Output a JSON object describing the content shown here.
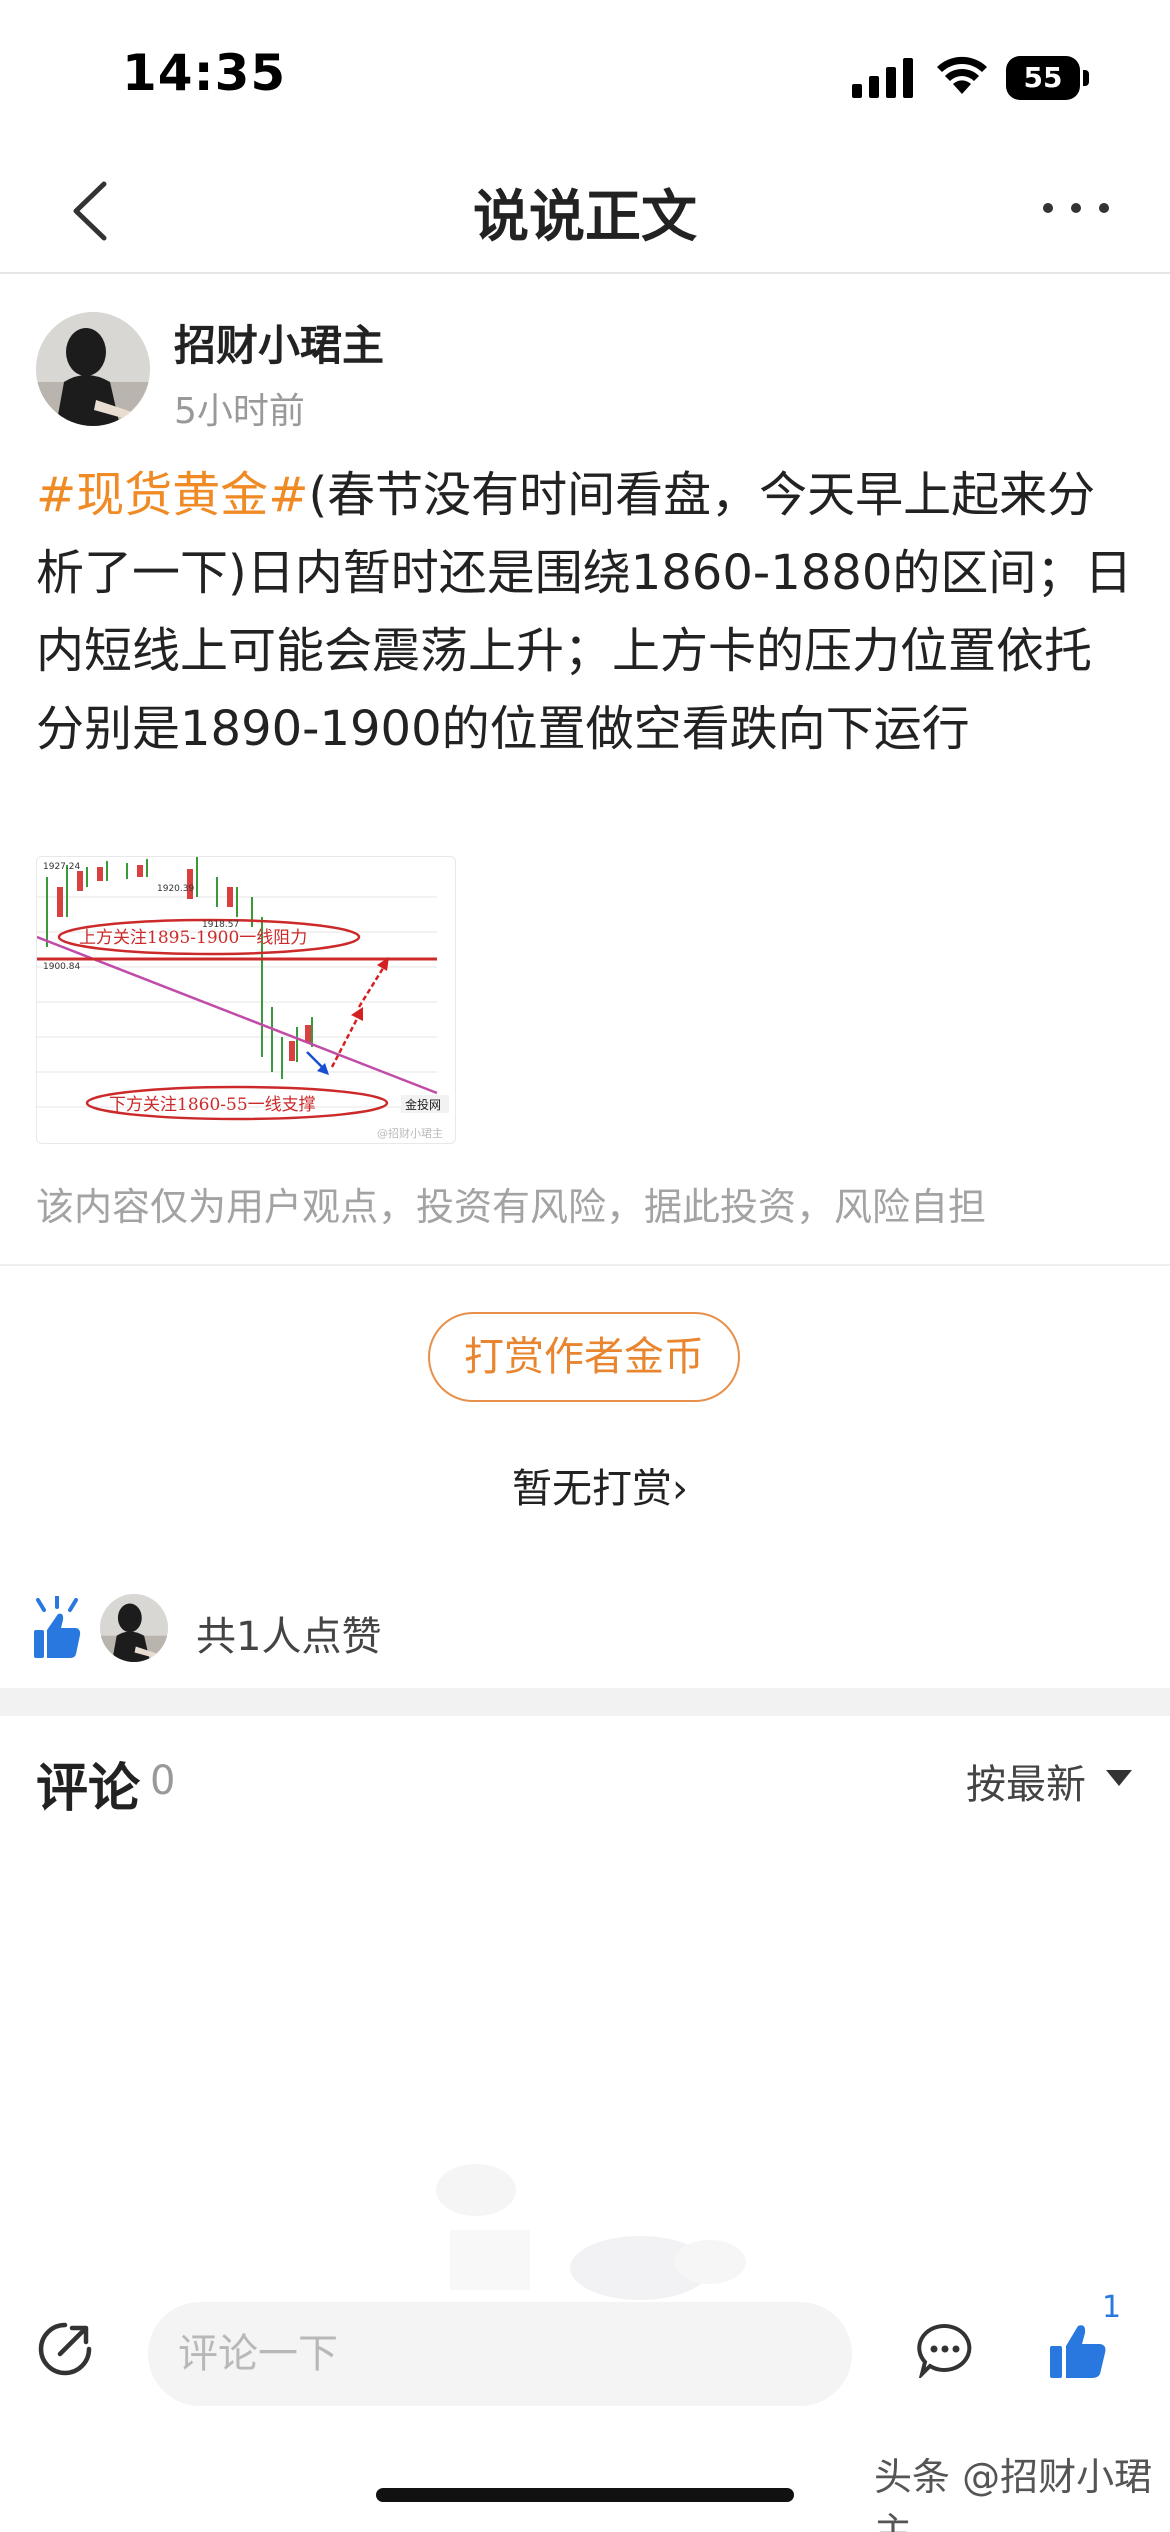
{
  "status_bar": {
    "time": "14:35",
    "battery": "55"
  },
  "nav": {
    "title": "说说正文"
  },
  "post": {
    "author": "招财小珺主",
    "time_ago": "5小时前",
    "hashtag": "#现货黄金#",
    "body": "(春节没有时间看盘，今天早上起来分析了一下)日内暂时还是围绕1860-1880的区间；日内短线上可能会震荡上升；上方卡的压力位置依托分别是1890-1900的位置做空看跌向下运行",
    "image": {
      "label_top": "上方关注1895-1900一线阻力",
      "label_bottom": "下方关注1860-55一线支撑",
      "price_labels": [
        "1927.24",
        "1920.39",
        "1918.57",
        "1900.84"
      ],
      "site_mark": "金投网",
      "source_mark": "@招财小珺主"
    },
    "disclaimer": "该内容仅为用户观点，投资有风险，据此投资，风险自担"
  },
  "tip": {
    "button_label": "打赏作者金币",
    "no_tip_text": "暂无打赏",
    "chevron": "›"
  },
  "likes": {
    "text": "共1人点赞"
  },
  "comments": {
    "title": "评论",
    "count": "0",
    "sort_label": "按最新"
  },
  "bottom_bar": {
    "input_placeholder": "评论一下",
    "like_count": "1"
  },
  "watermark": "头条 @招财小珺主",
  "colors": {
    "accent_orange": "#f08a24",
    "like_blue": "#2878e0"
  },
  "icons": [
    "signal-icon",
    "wifi-icon",
    "back-icon",
    "more-icon",
    "like-icon",
    "share-icon",
    "comment-bubble-icon",
    "thumb-up-icon",
    "sort-arrow-icon"
  ]
}
